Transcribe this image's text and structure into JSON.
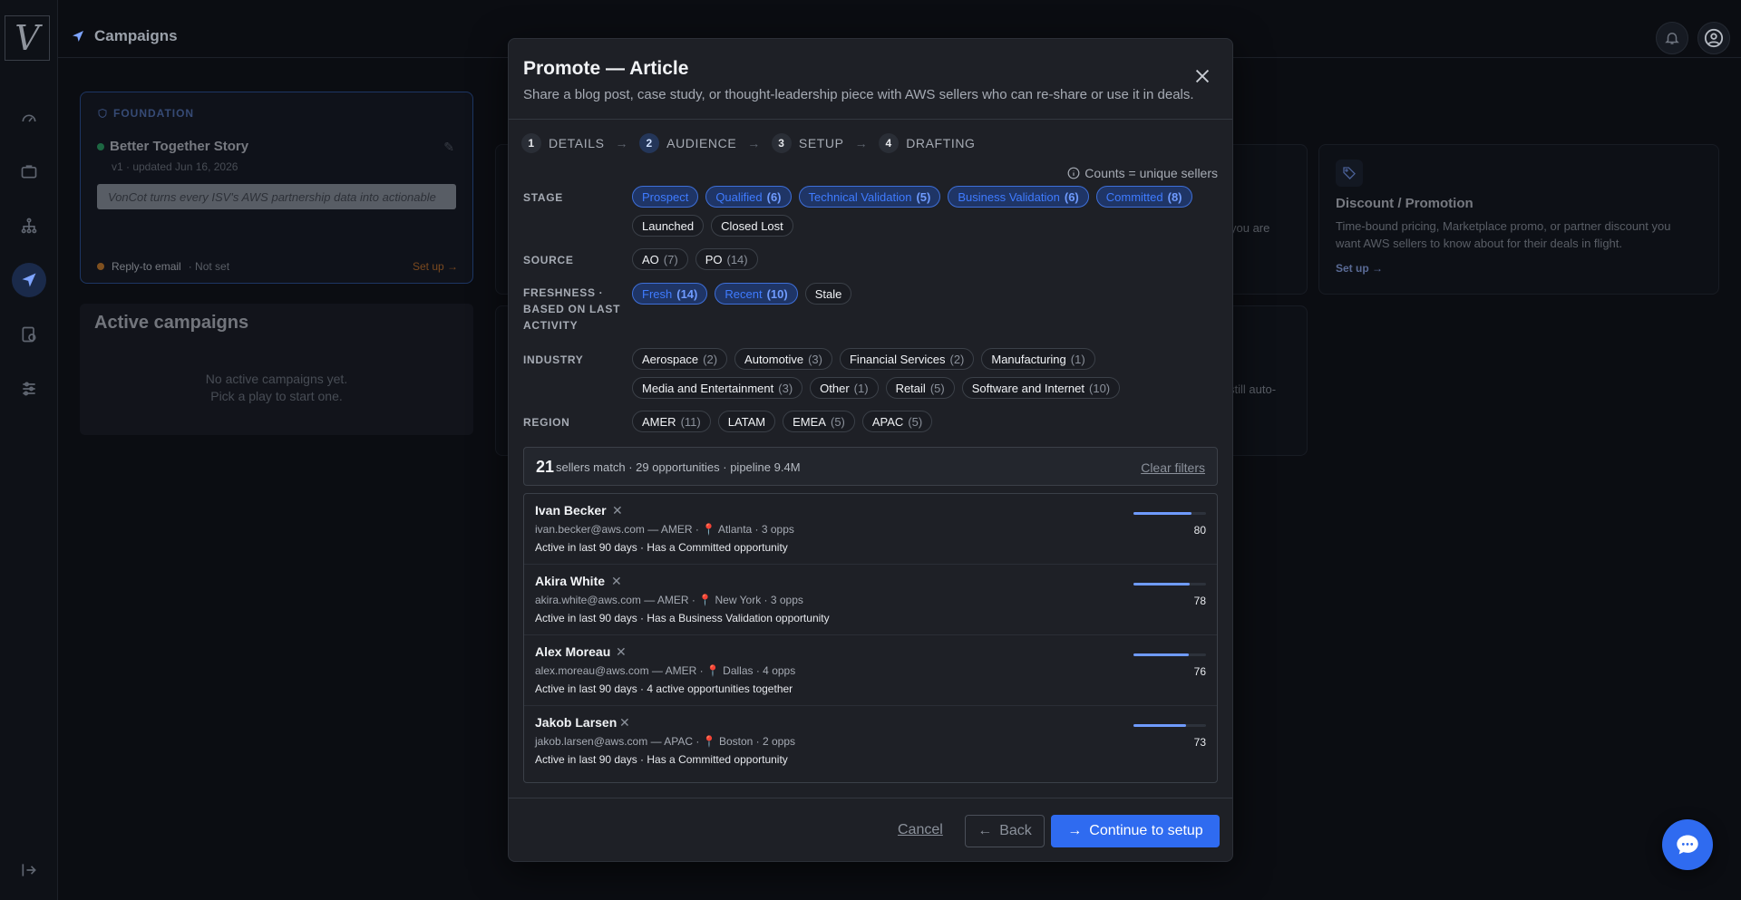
{
  "app": {
    "logo_text": "V",
    "page_title": "Campaigns"
  },
  "nav": {
    "items": [
      {
        "name": "dashboard",
        "icon": "gauge-icon"
      },
      {
        "name": "briefcase",
        "icon": "briefcase-icon"
      },
      {
        "name": "network",
        "icon": "hierarchy-icon"
      },
      {
        "name": "campaigns",
        "icon": "send-icon",
        "active": true
      },
      {
        "name": "billing",
        "icon": "receipt-icon"
      },
      {
        "name": "settings",
        "icon": "sliders-icon"
      }
    ],
    "collapse_icon": "collapse-icon"
  },
  "background": {
    "foundation": {
      "tag": "FOUNDATION",
      "title": "Better Together Story",
      "meta": "v1 · updated Jun 16, 2026",
      "preview": "VonCot turns every ISV's AWS partnership data into actionable",
      "reply_label": "Reply-to email",
      "reply_value": "· Not set",
      "setup_label": "Set up →"
    },
    "active_campaigns": {
      "title": "Active campaigns",
      "empty_line1": "No active campaigns yet.",
      "empty_line2": "Pick a play to start one."
    },
    "discount_card": {
      "title": "Discount / Promotion",
      "desc": "Time-bound pricing, Marketplace promo, or partner discount you want AWS sellers to know about for their deals in flight.",
      "setup_label": "Set up →"
    },
    "peek_1": "you are",
    "peek_2": "still auto-"
  },
  "modal": {
    "title": "Promote — Article",
    "subtitle": "Share a blog post, case study, or thought-leadership piece with AWS sellers who can re-share or use it in deals.",
    "steps": [
      {
        "num": "1",
        "label": "DETAILS"
      },
      {
        "num": "2",
        "label": "AUDIENCE",
        "active": true
      },
      {
        "num": "3",
        "label": "SETUP"
      },
      {
        "num": "4",
        "label": "DRAFTING"
      }
    ],
    "counts_note": "Counts = unique sellers",
    "filters": {
      "stage": {
        "label": "STAGE",
        "chips": [
          {
            "label": "Prospect",
            "count": "",
            "selected": true
          },
          {
            "label": "Qualified",
            "count": "(6)",
            "selected": true
          },
          {
            "label": "Technical Validation",
            "count": "(5)",
            "selected": true
          },
          {
            "label": "Business Validation",
            "count": "(6)",
            "selected": true
          },
          {
            "label": "Committed",
            "count": "(8)",
            "selected": true
          },
          {
            "label": "Launched",
            "count": "",
            "selected": false
          },
          {
            "label": "Closed Lost",
            "count": "",
            "selected": false
          }
        ]
      },
      "source": {
        "label": "SOURCE",
        "chips": [
          {
            "label": "AO",
            "count": "(7)",
            "selected": false
          },
          {
            "label": "PO",
            "count": "(14)",
            "selected": false
          }
        ]
      },
      "freshness": {
        "label_line1": "FRESHNESS ·",
        "label_line2": "BASED ON LAST",
        "label_line3": "ACTIVITY",
        "chips": [
          {
            "label": "Fresh",
            "count": "(14)",
            "selected": true
          },
          {
            "label": "Recent",
            "count": "(10)",
            "selected": true
          },
          {
            "label": "Stale",
            "count": "",
            "selected": false
          }
        ]
      },
      "industry": {
        "label": "INDUSTRY",
        "chips": [
          {
            "label": "Aerospace",
            "count": "(2)",
            "selected": false
          },
          {
            "label": "Automotive",
            "count": "(3)",
            "selected": false
          },
          {
            "label": "Financial Services",
            "count": "(2)",
            "selected": false
          },
          {
            "label": "Manufacturing",
            "count": "(1)",
            "selected": false
          },
          {
            "label": "Media and Entertainment",
            "count": "(3)",
            "selected": false
          },
          {
            "label": "Other",
            "count": "(1)",
            "selected": false
          },
          {
            "label": "Retail",
            "count": "(5)",
            "selected": false
          },
          {
            "label": "Software and Internet",
            "count": "(10)",
            "selected": false
          }
        ]
      },
      "region": {
        "label": "REGION",
        "chips": [
          {
            "label": "AMER",
            "count": "(11)",
            "selected": false
          },
          {
            "label": "LATAM",
            "count": "",
            "selected": false
          },
          {
            "label": "EMEA",
            "count": "(5)",
            "selected": false
          },
          {
            "label": "APAC",
            "count": "(5)",
            "selected": false
          }
        ]
      }
    },
    "summary": {
      "count": "21",
      "text": "sellers match · 29 opportunities · pipeline 9.4M",
      "clear_label": "Clear filters"
    },
    "sellers": [
      {
        "name": "Ivan Becker",
        "meta": "ivan.becker@aws.com — AMER · 📍 Atlanta · 3 opps",
        "tags": "Active in last 90 days · Has a Committed opportunity",
        "score": 80
      },
      {
        "name": "Akira White",
        "meta": "akira.white@aws.com — AMER · 📍 New York · 3 opps",
        "tags": "Active in last 90 days · Has a Business Validation opportunity",
        "score": 78
      },
      {
        "name": "Alex Moreau",
        "meta": "alex.moreau@aws.com — AMER · 📍 Dallas · 4 opps",
        "tags": "Active in last 90 days · 4 active opportunities together",
        "score": 76
      },
      {
        "name": "Jakob Larsen",
        "meta": "jakob.larsen@aws.com — APAC · 📍 Boston · 2 opps",
        "tags": "Active in last 90 days · Has a Committed opportunity",
        "score": 73
      }
    ],
    "footer": {
      "cancel_label": "Cancel",
      "back_label": "Back",
      "continue_label": "Continue to setup"
    }
  },
  "colors": {
    "accent": "#2f6bf0",
    "selected_chip_bg": "#1f3566",
    "selected_chip_text": "#3f7bff"
  }
}
